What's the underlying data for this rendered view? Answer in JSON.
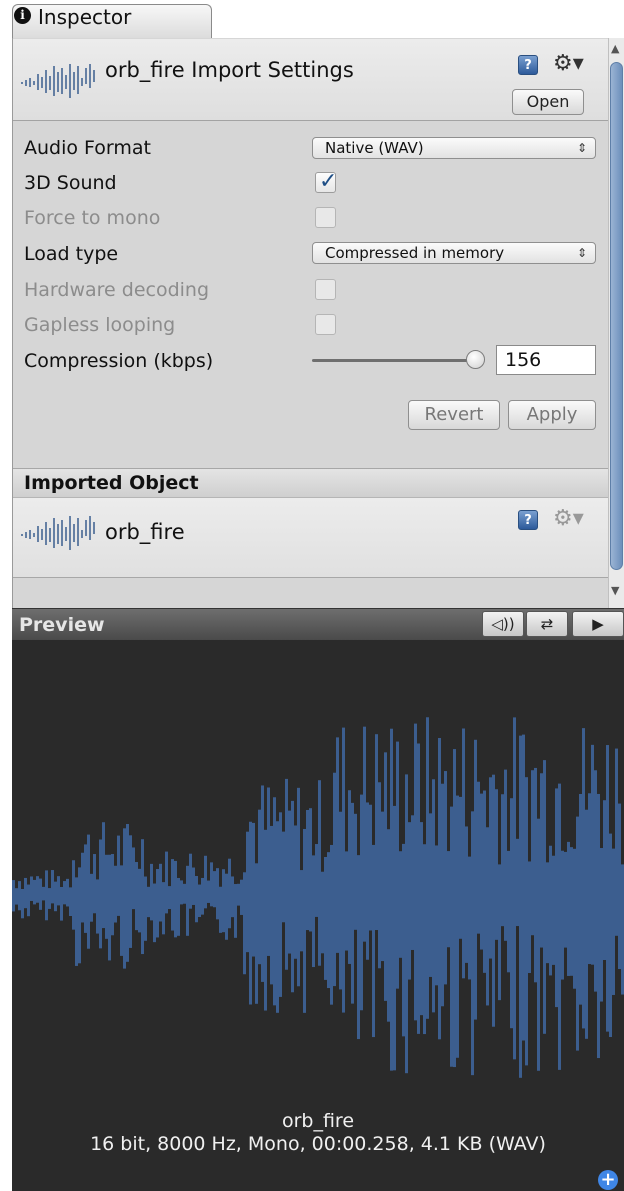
{
  "tab": {
    "label": "Inspector",
    "info_icon_glyph": "i"
  },
  "header": {
    "title": "orb_fire Import Settings",
    "open_label": "Open",
    "help_icon": "help-book-icon",
    "gear_icon": "gear-dropdown-icon"
  },
  "settings": {
    "audio_format": {
      "label": "Audio Format",
      "value": "Native (WAV)"
    },
    "sound_3d": {
      "label": "3D Sound",
      "checked": true
    },
    "force_mono": {
      "label": "Force to mono",
      "checked": false
    },
    "load_type": {
      "label": "Load type",
      "value": "Compressed in memory"
    },
    "hardware_decoding": {
      "label": "Hardware decoding",
      "checked": false
    },
    "gapless_looping": {
      "label": "Gapless looping",
      "checked": false
    },
    "compression": {
      "label": "Compression (kbps)",
      "value": "156",
      "slider_fraction": 1.0
    }
  },
  "actions": {
    "revert": "Revert",
    "apply": "Apply"
  },
  "imported": {
    "title": "Imported Object",
    "name": "orb_fire"
  },
  "preview": {
    "title": "Preview",
    "file_name": "orb_fire",
    "details": "16 bit, 8000 Hz, Mono, 00:00.258, 4.1 KB (WAV)"
  },
  "colors": {
    "waveform": "#3c5e8f",
    "preview_bg": "#2a2a2a",
    "panel_bg": "#d6d6d6"
  }
}
